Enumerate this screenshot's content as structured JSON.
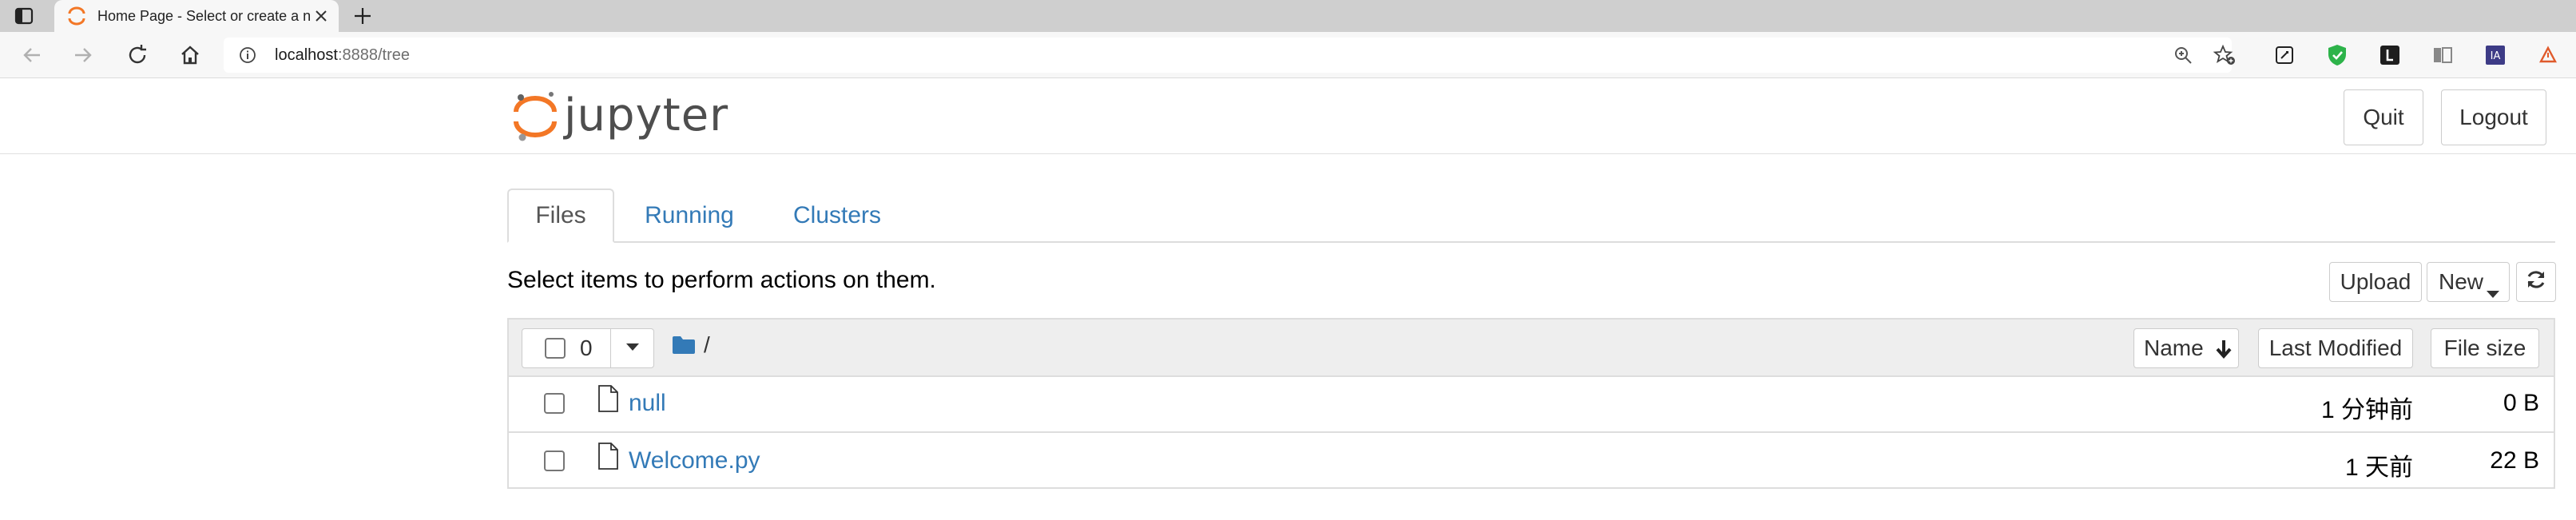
{
  "browser": {
    "tab_title": "Home Page - Select or create a n",
    "url_host": "localhost",
    "url_path": ":8888/tree"
  },
  "header": {
    "logo_text": "jupyter",
    "quit_label": "Quit",
    "logout_label": "Logout"
  },
  "tabs": [
    {
      "label": "Files"
    },
    {
      "label": "Running"
    },
    {
      "label": "Clusters"
    }
  ],
  "toolbar": {
    "hint": "Select items to perform actions on them.",
    "upload_label": "Upload",
    "new_label": "New"
  },
  "list_header": {
    "selected_count": "0",
    "path": "/",
    "name_label": "Name",
    "last_modified_label": "Last Modified",
    "file_size_label": "File size"
  },
  "files": [
    {
      "name": "null",
      "modified": "1 分钟前",
      "size": "0 B"
    },
    {
      "name": "Welcome.py",
      "modified": "1 天前",
      "size": "22 B"
    }
  ],
  "colors": {
    "link": "#337ab7",
    "jupyter_orange": "#f37726",
    "folder": "#337ab7"
  }
}
